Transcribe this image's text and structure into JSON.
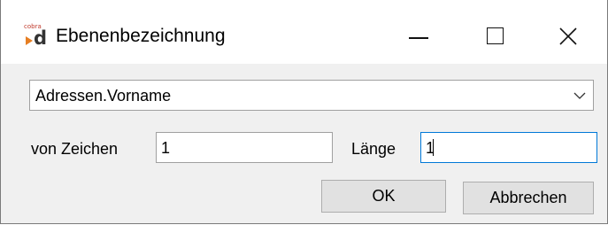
{
  "window": {
    "title": "Ebenenbezeichnung",
    "icon": "cobra-d-icon",
    "icon_brand_text": "cobra"
  },
  "combo": {
    "selected": "Adressen.Vorname"
  },
  "fields": {
    "von_label": "von Zeichen",
    "von_value": "1",
    "laenge_label": "Länge",
    "laenge_value": "1"
  },
  "buttons": {
    "ok": "OK",
    "cancel": "Abbrechen"
  },
  "colors": {
    "focus_border": "#0078d7",
    "button_bg": "#e1e1e1",
    "dialog_bg": "#f0f0f0"
  }
}
